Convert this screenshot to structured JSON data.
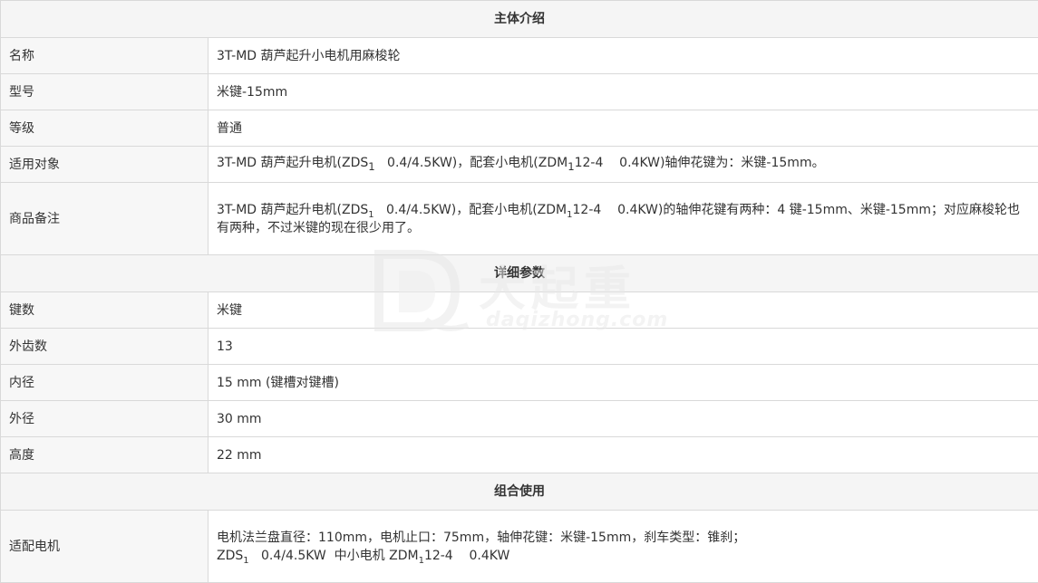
{
  "sections": {
    "intro_title": "主体介绍",
    "detail_title": "详细参数",
    "combo_title": "组合使用"
  },
  "intro": {
    "name_label": "名称",
    "name_value": "3T-MD 葫芦起升小电机用麻梭轮",
    "model_label": "型号",
    "model_value": "米键-15mm",
    "grade_label": "等级",
    "grade_value": "普通",
    "applicable_label": "适用对象",
    "applicable_value_a": "3T-MD 葫芦起升电机(ZDS",
    "applicable_value_b": "1",
    "applicable_value_c": "   0.4/4.5KW)，配套小电机(ZDM",
    "applicable_value_d": "1",
    "applicable_value_e": "12-4    0.4KW)轴伸花键为：米键-15mm。",
    "remark_label": "商品备注",
    "remark_line1_a": "3T-MD 葫芦起升电机(ZDS",
    "remark_line1_b": "1",
    "remark_line1_c": "   0.4/4.5KW)，配套小电机(ZDM",
    "remark_line1_d": "1",
    "remark_line1_e": "12-4    0.4KW)的轴伸花键有两种：4 键-15mm、米键-15mm；对应麻梭轮也",
    "remark_line2": "有两种，不过米键的现在很少用了。"
  },
  "details": {
    "keys_label": "键数",
    "keys_value": "米键",
    "teeth_label": "外齿数",
    "teeth_value": "13",
    "inner_label": "内径",
    "inner_value": "15 mm (键槽对键槽)",
    "outer_label": "外径",
    "outer_value": "30 mm",
    "height_label": "高度",
    "height_value": "22 mm"
  },
  "combo": {
    "motor_label": "适配电机",
    "motor_line1": "电机法兰盘直径：110mm，电机止口：75mm，轴伸花键：米键-15mm，刹车类型：锥刹；",
    "motor_line2_a": "ZDS",
    "motor_line2_b": "1",
    "motor_line2_c": "   0.4/4.5KW  中小电机 ZDM",
    "motor_line2_d": "1",
    "motor_line2_e": "12-4    0.4KW"
  },
  "watermark": {
    "name": "大起重",
    "url": "daqizhong.com"
  }
}
